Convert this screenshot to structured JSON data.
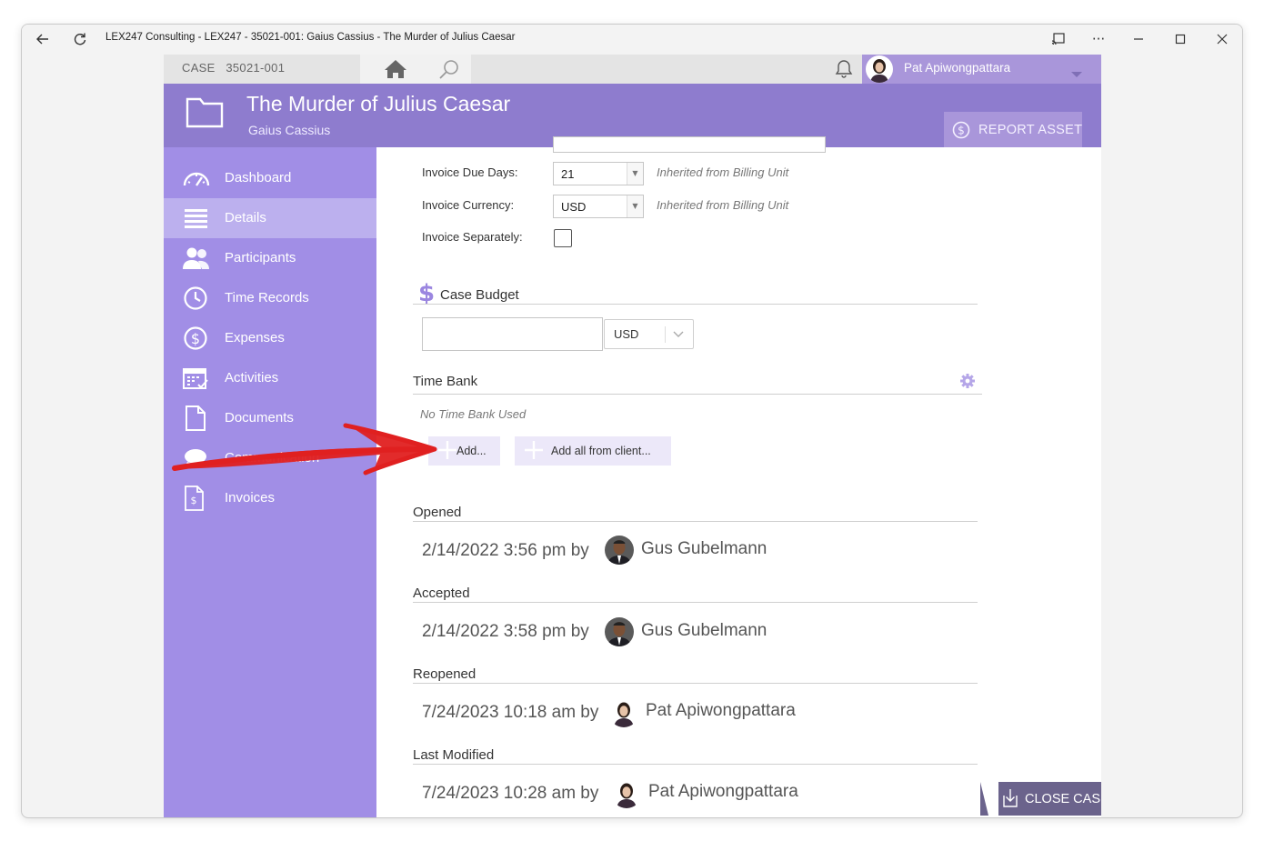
{
  "window": {
    "title": "LEX247 Consulting - LEX247 - 35021-001: Gaius Cassius - The Murder of Julius Caesar",
    "icons": [
      "back-arrow-icon",
      "refresh-icon",
      "cast-icon",
      "more-icon",
      "minimize-icon",
      "maximize-icon",
      "close-icon"
    ]
  },
  "topbar": {
    "case_label": "CASE",
    "case_number": "35021-001",
    "user_name": "Pat Apiwongpattara"
  },
  "header": {
    "title": "The Murder of Julius Caesar",
    "client": "Gaius Cassius",
    "report_asset": "REPORT ASSET"
  },
  "sidebar": {
    "items": [
      {
        "label": "Dashboard",
        "icon": "dashboard-icon"
      },
      {
        "label": "Details",
        "icon": "list-icon"
      },
      {
        "label": "Participants",
        "icon": "people-icon"
      },
      {
        "label": "Time Records",
        "icon": "clock-icon"
      },
      {
        "label": "Expenses",
        "icon": "dollar-circle-icon"
      },
      {
        "label": "Activities",
        "icon": "calendar-icon"
      },
      {
        "label": "Documents",
        "icon": "document-icon"
      },
      {
        "label": "Communication",
        "icon": "chat-icon"
      },
      {
        "label": "Invoices",
        "icon": "invoice-icon"
      }
    ],
    "active": "Details"
  },
  "billing": {
    "invoice_due_days_label": "Invoice Due Days:",
    "invoice_due_days_value": "21",
    "invoice_currency_label": "Invoice Currency:",
    "invoice_currency_value": "USD",
    "inherited_note": "Inherited from Billing Unit",
    "invoice_separately_label": "Invoice Separately:"
  },
  "budget": {
    "title": "Case Budget",
    "currency": "USD"
  },
  "time_bank": {
    "title": "Time Bank",
    "empty_note": "No Time Bank Used",
    "add_label": "Add...",
    "add_all_label": "Add all from client..."
  },
  "history": {
    "opened": {
      "label": "Opened",
      "stamp": "2/14/2022 3:56 pm by",
      "person": "Gus Gubelmann"
    },
    "accepted": {
      "label": "Accepted",
      "stamp": "2/14/2022 3:58 pm by",
      "person": "Gus Gubelmann"
    },
    "reopened": {
      "label": "Reopened",
      "stamp": "7/24/2023 10:18 am by",
      "person": "Pat Apiwongpattara"
    },
    "last_modified": {
      "label": "Last Modified",
      "stamp": "7/24/2023 10:28 am by",
      "person": "Pat Apiwongpattara"
    }
  },
  "actions": {
    "close_case": "CLOSE CASE"
  },
  "colors": {
    "sidebar": "#a18ee6",
    "sidebar_active": "#bcb0ee",
    "header": "#8e7cce",
    "accent_light": "#a996da",
    "close_case_bg": "#6b638c",
    "annotation_arrow": "#e02020"
  }
}
